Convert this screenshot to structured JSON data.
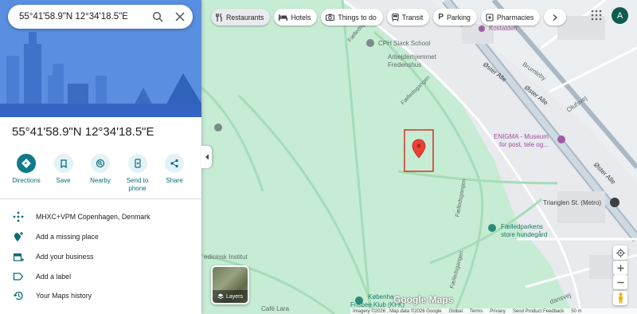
{
  "search": {
    "query": "55°41'58.9\"N 12°34'18.5\"E"
  },
  "place": {
    "title": "55°41'58.9\"N 12°34'18.5\"E"
  },
  "actions": [
    {
      "label": "Directions",
      "icon": "directions-icon"
    },
    {
      "label": "Save",
      "icon": "bookmark-icon"
    },
    {
      "label": "Nearby",
      "icon": "nearby-icon"
    },
    {
      "label": "Send to phone",
      "icon": "phone-icon"
    },
    {
      "label": "Share",
      "icon": "share-icon"
    }
  ],
  "details": [
    {
      "text": "MHXC+VPM Copenhagen, Denmark",
      "icon": "plus-code-icon"
    },
    {
      "text": "Add a missing place",
      "icon": "add-place-icon"
    },
    {
      "text": "Add your business",
      "icon": "business-icon"
    },
    {
      "text": "Add a label",
      "icon": "label-icon"
    },
    {
      "text": "Your Maps history",
      "icon": "history-icon"
    }
  ],
  "chips": [
    "Restaurants",
    "Hotels",
    "Things to do",
    "Transit",
    "Parking",
    "Pharmacies"
  ],
  "user": {
    "avatar_letter": "A"
  },
  "map": {
    "labels": {
      "kostalden": "Kostalden",
      "cph_slack": "CPH Slack School",
      "arbejder1": "Arbejderhjemmet",
      "arbejder2": "Fredenshus",
      "osterallE1": "Øster Alle",
      "osterallE2": "Øster Alle",
      "osterallE3": "Øster Alle",
      "olufsvej": "Olufsvej",
      "brumleby": "Brumleby",
      "enigma1": "ENIGMA - Museum",
      "enigma2": "for post, tele og...",
      "trianglen": "Trianglen St. (Metro)",
      "faelled1": "Fælledparkens",
      "faelled2": "store hundegård",
      "faelledsgangen1": "Fælledsgangen",
      "faelledsgangen2": "Fælledsgangen",
      "faelledsgangen3": "Fælledsgangen",
      "faelledsgangen4": "Fælledsgangen",
      "medicinsk": "edicinsk Institut",
      "cafe": "Café Lara",
      "kbh1": "Københa",
      "kbh2": "Frisbee Klub (KFK)",
      "dansvej": "dansvej",
      "gm": "Google Maps"
    },
    "layers_label": "Layers",
    "footer": [
      "Imagery ©2026 , Map data ©2026 Google",
      "Global",
      "Terms",
      "Privacy",
      "Send Product Feedback",
      "50 m"
    ],
    "marker_color": "#ea4335",
    "highlight_color": "#d93025"
  }
}
